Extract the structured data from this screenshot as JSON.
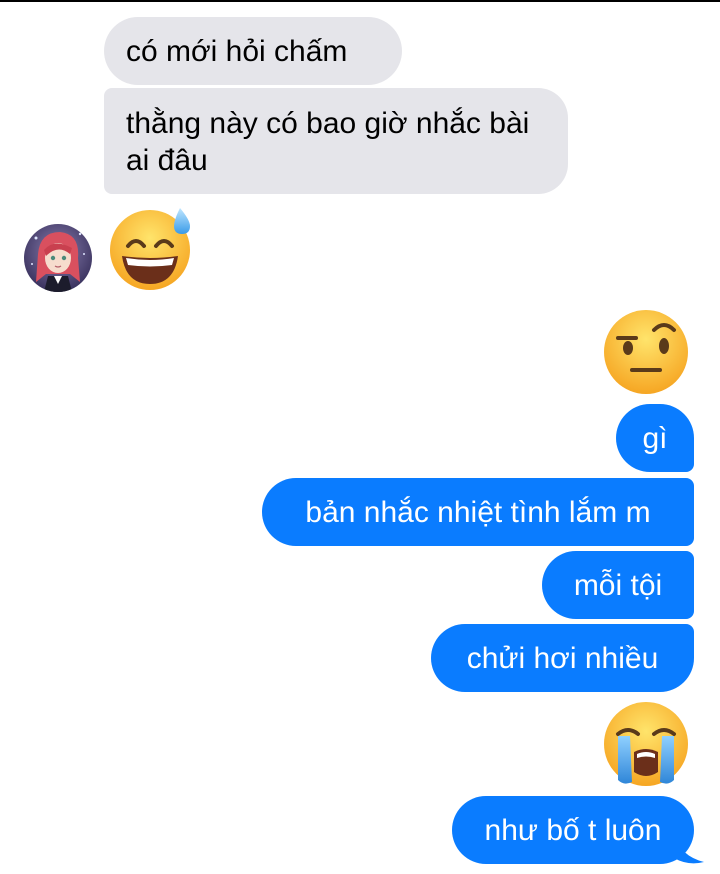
{
  "conversation": {
    "incoming": [
      {
        "text": "có mới hỏi chấm"
      },
      {
        "text": "thằng này có bao giờ nhắc bài ai đâu"
      }
    ],
    "incoming_emoji": {
      "icon": "grinning-face-with-sweat-icon"
    },
    "outgoing_emoji_1": {
      "icon": "face-with-raised-eyebrow-icon"
    },
    "outgoing": [
      {
        "text": "gì"
      },
      {
        "text": "bản nhắc nhiệt tình lắm m"
      },
      {
        "text": "mỗi tội"
      },
      {
        "text": "chửi hơi nhiều"
      }
    ],
    "outgoing_emoji_2": {
      "icon": "loudly-crying-face-icon"
    },
    "last_outgoing": {
      "text": "như bố t luôn"
    }
  },
  "colors": {
    "incoming_bubble": "#e5e5ea",
    "outgoing_bubble": "#0a7cff",
    "emoji_yellow": "#ffc93a"
  }
}
